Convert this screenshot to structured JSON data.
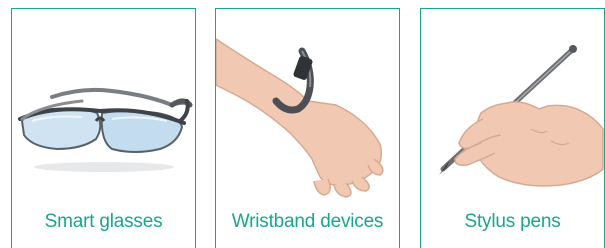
{
  "panels": [
    {
      "caption": "Smart glasses",
      "icon": "smart-glasses-icon"
    },
    {
      "caption": "Wristband devices",
      "icon": "wristband-icon"
    },
    {
      "caption": "Stylus pens",
      "icon": "stylus-pen-icon"
    }
  ],
  "colors": {
    "accent": "#1aa58f",
    "lens": "#cfe3f3",
    "skin": "#f1c9b3",
    "metal": "#6d6f73"
  }
}
